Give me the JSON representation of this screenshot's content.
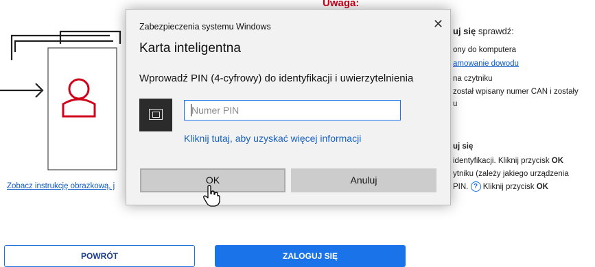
{
  "background": {
    "warning_title": "Uwaga:",
    "right_heading_tail": "uj się",
    "right_heading_rest": " sprawdź:",
    "right_line1": "ony do komputera",
    "right_link": "amowanie dowodu",
    "right_line3": "na czytniku",
    "right_line4": " został wpisany numer CAN i zostały",
    "right_line5": "u",
    "right_heading2": "uj się",
    "right_line6_pre": " identyfikacji. Kliknij przycisk ",
    "right_line6_bold": "OK",
    "right_line7": "ytniku (zależy jakiego urządzenia",
    "right_line8_pre": "PIN. ",
    "right_help_glyph": "?",
    "right_line8_mid": " Kliknij przycisk ",
    "right_line8_bold": "OK",
    "instruction_link": "Zobacz instrukcję obrazkową, j",
    "back_button": "POWRÓT",
    "login_button": "ZALOGUJ SIĘ"
  },
  "dialog": {
    "caption": "Zabezpieczenia systemu Windows",
    "close_glyph": "✕",
    "title": "Karta inteligentna",
    "prompt": "Wprowadź PIN (4-cyfrowy) do identyfikacji i uwierzytelnienia",
    "pin_placeholder": "Numer PIN",
    "more_info_link": "Kliknij tutaj, aby uzyskać więcej informacji",
    "ok_button": "OK",
    "cancel_button": "Anuluj"
  },
  "icons": {
    "illustration": "smart-card-login-illustration",
    "card_tile": "smart-card-icon",
    "cursor": "hand-pointer-icon",
    "help": "help-circle-icon"
  },
  "colors": {
    "accent_red": "#d0021b",
    "accent_blue": "#1a73e8",
    "link_blue": "#1560c0"
  }
}
